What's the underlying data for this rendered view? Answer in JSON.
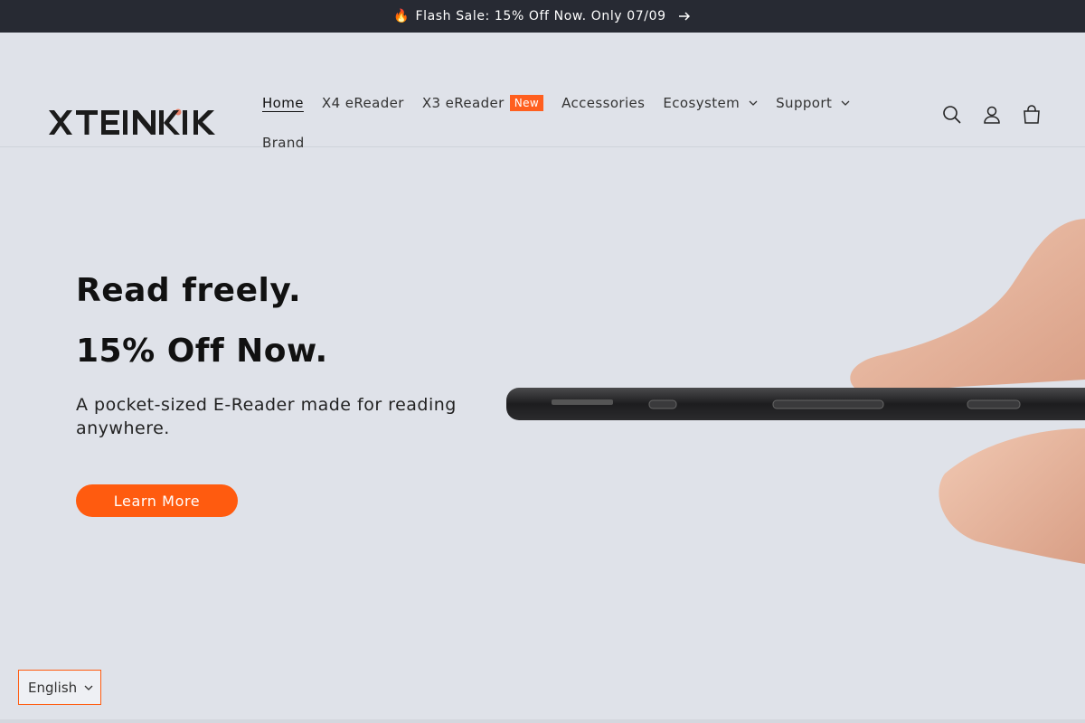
{
  "announcement": {
    "emoji": "🔥",
    "text": "Flash Sale: 15% Off Now. Only 07/09"
  },
  "brand": {
    "logo_text": "XTEINK",
    "accent_color": "#ff5b0f"
  },
  "nav": {
    "items": [
      {
        "label": "Home",
        "active": true
      },
      {
        "label": "X4 eReader"
      },
      {
        "label": "X3 eReader",
        "badge": "New"
      },
      {
        "label": "Accessories"
      },
      {
        "label": "Ecosystem",
        "dropdown": true
      },
      {
        "label": "Support",
        "dropdown": true
      },
      {
        "label": "Brand"
      }
    ]
  },
  "header_icons": [
    "search-icon",
    "account-icon",
    "cart-icon"
  ],
  "hero": {
    "title_line1": "Read freely.",
    "title_line2": "15% Off Now.",
    "subtitle": "A pocket-sized E-Reader made for reading anywhere.",
    "cta_label": "Learn More"
  },
  "language": {
    "selected": "English"
  },
  "colors": {
    "announcement_bg": "#272a33",
    "page_bg": "#dfe2e9",
    "badge_bg": "#ff5f1f"
  }
}
